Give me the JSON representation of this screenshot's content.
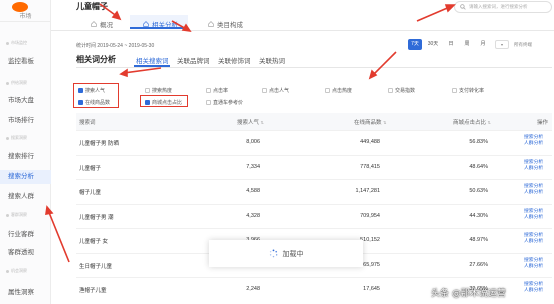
{
  "sidebar": {
    "brand": "市场",
    "groups": [
      "市场监控",
      "供给洞察",
      "搜索洞察",
      "客群洞察",
      "机会洞察"
    ],
    "items": [
      "监控看板",
      "市场大盘",
      "市场排行",
      "搜索排行",
      "搜索分析",
      "搜索人群",
      "行业客群",
      "客群透视",
      "属性洞察"
    ],
    "active": "搜索分析"
  },
  "header": {
    "title": "儿童帽子",
    "tabs": [
      "概况",
      "相关分析",
      "类目构成"
    ],
    "search_placeholder": "请输入搜索词，进行搜索分析"
  },
  "date_bar": {
    "stat_time": "统计时间 2019-05-24 ~ 2019-05-30",
    "ranges": [
      "7天",
      "30天",
      "日",
      "周",
      "月"
    ],
    "active_range": "7天",
    "all_terminal": "所有终端"
  },
  "section": {
    "title": "相关词分析",
    "subtabs": [
      "相关搜索词",
      "关联品牌词",
      "关联修饰词",
      "关联热词"
    ],
    "active_subtab": "相关搜索词"
  },
  "indicators": {
    "row1": [
      {
        "label": "搜索人气",
        "checked": true
      },
      {
        "label": "搜索热度",
        "checked": false
      },
      {
        "label": "点击率",
        "checked": false
      },
      {
        "label": "点击人气",
        "checked": false
      },
      {
        "label": "点击热度",
        "checked": false
      },
      {
        "label": "交易指数",
        "checked": false
      },
      {
        "label": "支付转化率",
        "checked": false
      }
    ],
    "row2": [
      {
        "label": "在线商品数",
        "checked": true
      },
      {
        "label": "商城点击占比",
        "checked": true
      },
      {
        "label": "直通车参考价",
        "checked": false
      }
    ]
  },
  "table": {
    "headers": [
      "搜索词",
      "搜索人气",
      "在线商品数",
      "商城点击占比",
      "操作"
    ],
    "rows": [
      {
        "keyword": "儿童帽子男 防晒",
        "popularity": "8,006",
        "online": "449,488",
        "mall_ratio": "56.83%"
      },
      {
        "keyword": "儿童帽子",
        "popularity": "7,334",
        "online": "778,415",
        "mall_ratio": "48.64%"
      },
      {
        "keyword": "帽子儿童",
        "popularity": "4,588",
        "online": "1,147,281",
        "mall_ratio": "50.63%"
      },
      {
        "keyword": "儿童帽子男 潮",
        "popularity": "4,328",
        "online": "709,954",
        "mall_ratio": "44.30%"
      },
      {
        "keyword": "儿童帽子 女",
        "popularity": "3,966",
        "online": "510,152",
        "mall_ratio": "48.97%"
      },
      {
        "keyword": "生日帽子儿童",
        "popularity": "2,798",
        "online": "65,975",
        "mall_ratio": "27.66%"
      },
      {
        "keyword": "渔帽子儿童",
        "popularity": "2,248",
        "online": "17,645",
        "mall_ratio": "39.65%"
      }
    ],
    "actions": [
      "搜索分析",
      "人群分析"
    ]
  },
  "loading_text": "加载中",
  "watermark": "头条 @那木说运营",
  "colors": {
    "accent": "#2f6bd8",
    "annotation_red": "#e23b2e",
    "brand": "#ff6a00"
  }
}
